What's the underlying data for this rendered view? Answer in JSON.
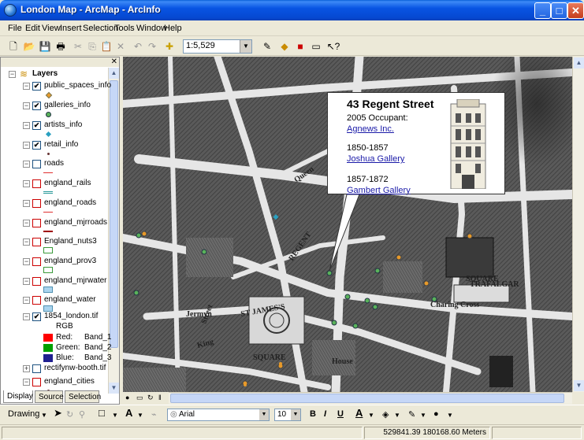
{
  "window": {
    "title": "London Map - ArcMap - ArcInfo"
  },
  "menu": [
    "File",
    "Edit",
    "View",
    "Insert",
    "Selection",
    "Tools",
    "Window",
    "Help"
  ],
  "toolbar": {
    "scale": "1:5,529"
  },
  "toc": {
    "root": "Layers",
    "layers": [
      {
        "name": "public_spaces_info",
        "checked": true,
        "symbol": "orange-diamond"
      },
      {
        "name": "galleries_info",
        "checked": true,
        "symbol": "green-dot"
      },
      {
        "name": "artists_info",
        "checked": true,
        "symbol": "blue-diamond"
      },
      {
        "name": "retail_info",
        "checked": true,
        "symbol": "small-dot"
      },
      {
        "name": "roads",
        "checked": false,
        "symbol": "red-line"
      },
      {
        "name": "england_rails",
        "checked": false,
        "symbol": "rail-line"
      },
      {
        "name": "england_roads",
        "checked": false,
        "symbol": "red-line"
      },
      {
        "name": "england_mjrroads",
        "checked": false,
        "symbol": "dark-red-line"
      },
      {
        "name": "England_nuts3",
        "checked": false,
        "symbol": "green-box"
      },
      {
        "name": "england_prov3",
        "checked": false,
        "symbol": "green-box"
      },
      {
        "name": "england_mjrwater",
        "checked": false,
        "symbol": "cyan-box"
      },
      {
        "name": "england_water",
        "checked": false,
        "symbol": "cyan-box"
      },
      {
        "name": "1854_london.tif",
        "checked": true,
        "symbol": "none"
      },
      {
        "name": "rectifynw-booth.tif",
        "checked": false,
        "symbol": "none"
      },
      {
        "name": "england_cities",
        "checked": false,
        "symbol": "small-dot"
      }
    ],
    "rgb": {
      "label": "RGB",
      "bands": [
        {
          "name": "Red:",
          "band": "Band_1",
          "color": "#ff0000"
        },
        {
          "name": "Green:",
          "band": "Band_2",
          "color": "#00a000"
        },
        {
          "name": "Blue:",
          "band": "Band_3",
          "color": "#202090"
        }
      ]
    },
    "tabs": [
      "Display",
      "Source",
      "Selection"
    ]
  },
  "popup": {
    "title": "43 Regent Street",
    "occupant_label": "2005 Occupant:",
    "occupant": "Agnews Inc.",
    "period1": "1850-1857",
    "gallery1": "Joshua Gallery",
    "period2": "1857-1872",
    "gallery2": "Gambert Gallery"
  },
  "drawing": {
    "label": "Drawing",
    "font": "Arial",
    "size": "10",
    "bold": "B",
    "italic": "I",
    "underline": "U"
  },
  "status": {
    "coords": "529841.39  180168.60 Meters"
  },
  "colors": {
    "accent": "#0854e3",
    "link": "#1a1aa8"
  }
}
